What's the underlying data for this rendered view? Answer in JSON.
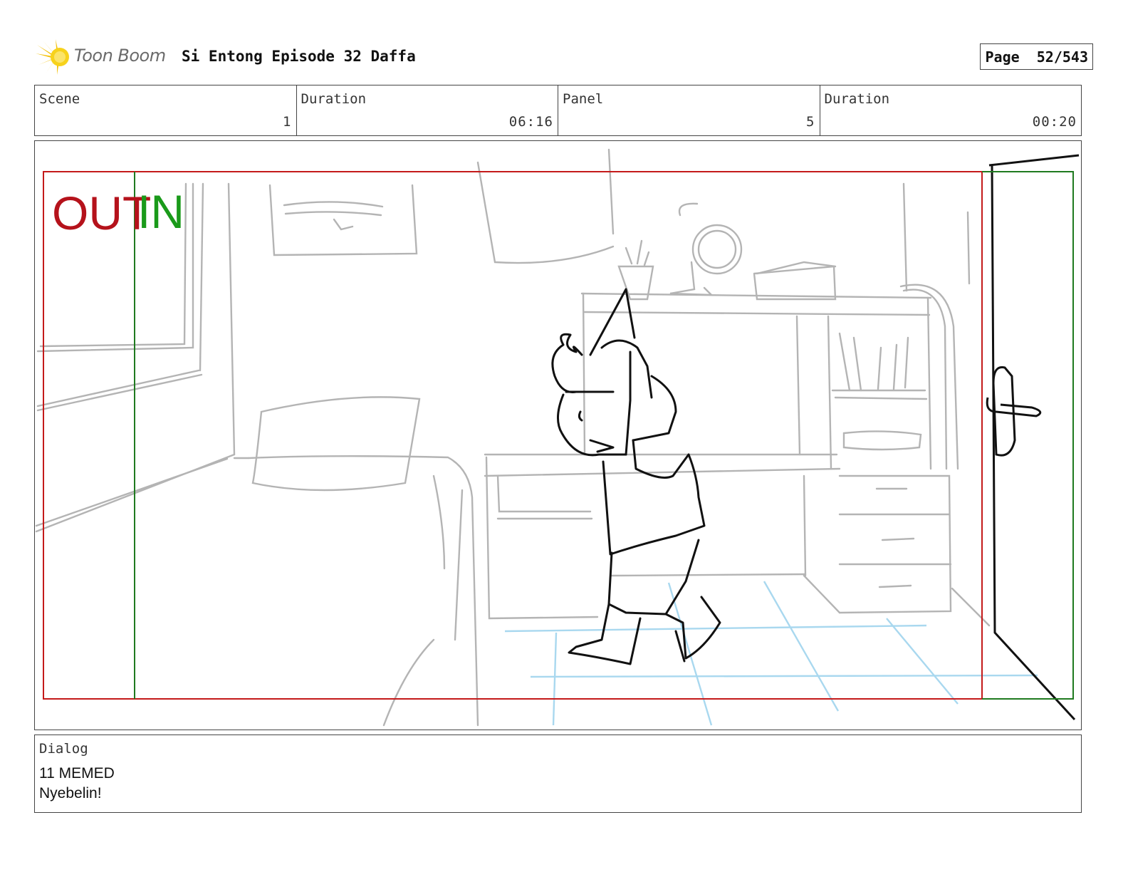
{
  "header": {
    "logo_text": "Toon Boom",
    "project_title": "Si Entong Episode 32 Daffa",
    "page_label": "Page",
    "page_value": "52/543"
  },
  "info": {
    "scene_label": "Scene",
    "scene_value": "1",
    "scene_duration_label": "Duration",
    "scene_duration_value": "06:16",
    "panel_label": "Panel",
    "panel_value": "5",
    "panel_duration_label": "Duration",
    "panel_duration_value": "00:20"
  },
  "frame": {
    "out_label": "OUT",
    "in_label": "IN",
    "out_color": "#b5121b",
    "in_color": "#1a9a1a"
  },
  "dialog": {
    "label": "Dialog",
    "line1": "11 MEMED",
    "line2": "Nyebelin!"
  }
}
